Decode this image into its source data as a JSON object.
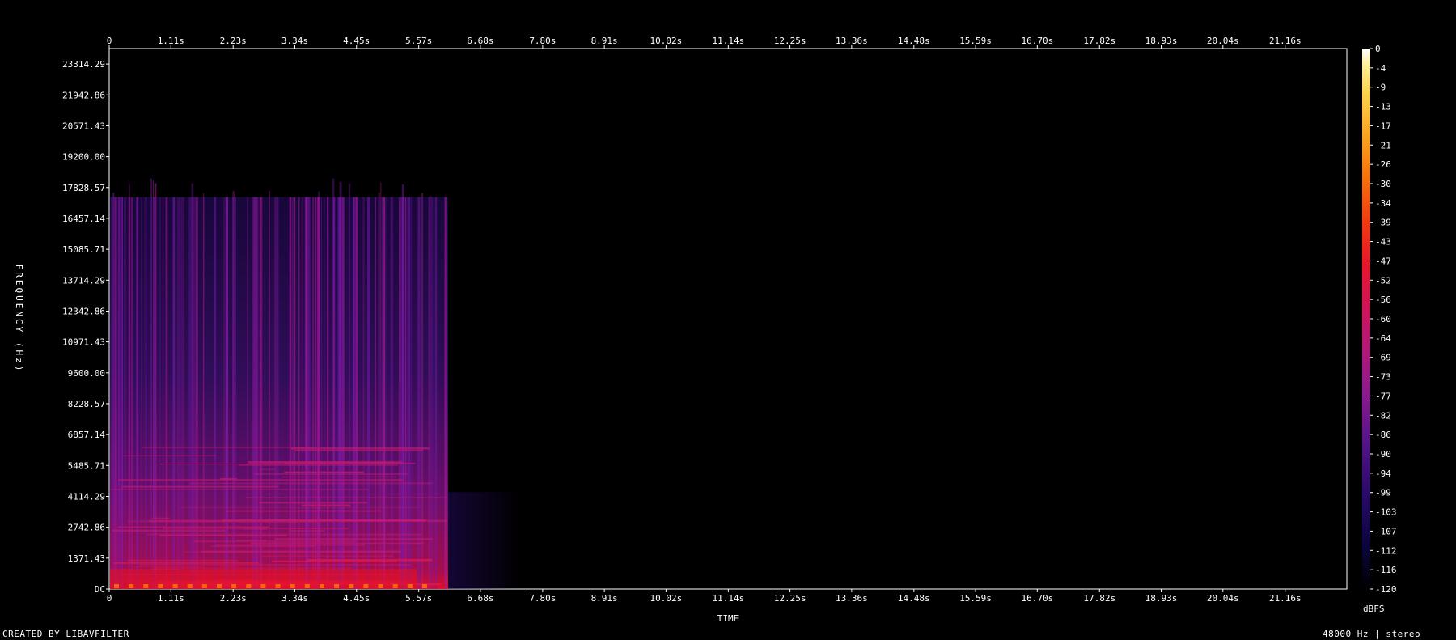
{
  "footer": {
    "created_by": "CREATED BY LIBAVFILTER",
    "sample_info": "48000 Hz | stereo"
  },
  "chart_data": {
    "type": "heatmap",
    "title": "",
    "xlabel": "TIME",
    "ylabel": "FREQUENCY (Hz)",
    "colorbar_label": "dBFS",
    "x_unit": "s",
    "x_ticks": [
      "0",
      "1.11s",
      "2.23s",
      "3.34s",
      "4.45s",
      "5.57s",
      "6.68s",
      "7.80s",
      "8.91s",
      "10.02s",
      "11.14s",
      "12.25s",
      "13.36s",
      "14.48s",
      "15.59s",
      "16.70s",
      "17.82s",
      "18.93s",
      "20.04s",
      "21.16s"
    ],
    "x_tick_values": [
      0,
      1.11,
      2.23,
      3.34,
      4.45,
      5.57,
      6.68,
      7.8,
      8.91,
      10.02,
      11.14,
      12.25,
      13.36,
      14.48,
      15.59,
      16.7,
      17.82,
      18.93,
      20.04,
      21.16
    ],
    "xlim": [
      0,
      22.27
    ],
    "y_ticks": [
      "DC",
      "1371.43",
      "2742.86",
      "4114.29",
      "5485.71",
      "6857.14",
      "8228.57",
      "9600.00",
      "10971.43",
      "12342.86",
      "13714.29",
      "15085.71",
      "16457.14",
      "17828.57",
      "19200.00",
      "20571.43",
      "21942.86",
      "23314.29"
    ],
    "y_tick_values": [
      0,
      1371.43,
      2742.86,
      4114.29,
      5485.71,
      6857.14,
      8228.57,
      9600.0,
      10971.43,
      12342.86,
      13714.29,
      15085.71,
      16457.14,
      17828.57,
      19200.0,
      20571.43,
      21942.86,
      23314.29
    ],
    "ylim": [
      0,
      24000
    ],
    "colorbar_ticks": [
      "0",
      "-4",
      "-9",
      "-13",
      "-17",
      "-21",
      "-26",
      "-30",
      "-34",
      "-39",
      "-43",
      "-47",
      "-52",
      "-56",
      "-60",
      "-64",
      "-69",
      "-73",
      "-77",
      "-82",
      "-86",
      "-90",
      "-94",
      "-99",
      "-103",
      "-107",
      "-112",
      "-116",
      "-120"
    ],
    "colorbar_range_db": [
      -120,
      0
    ],
    "colormap": [
      "#000000",
      "#0a0540",
      "#2a0a6a",
      "#5a148a",
      "#8a1a8e",
      "#b0187a",
      "#d0145a",
      "#e8162a",
      "#f23a10",
      "#f7700a",
      "#fba41e",
      "#fdd44e",
      "#ffef9a",
      "#ffffff"
    ],
    "audio_content_end_s": 6.1,
    "audio_max_freq_hz": 17400
  }
}
